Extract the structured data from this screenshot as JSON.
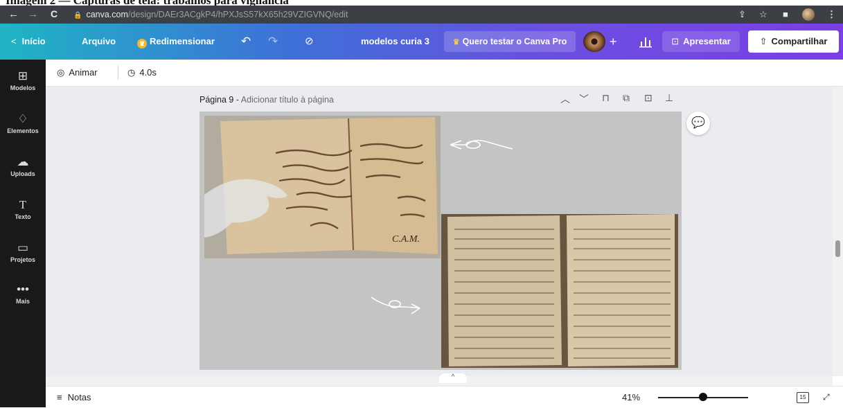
{
  "doc_caption": "Imagem 2 — Capturas de tela: trabalhos para vigilância",
  "browser": {
    "url_host": "canva.com",
    "url_path": "/design/DAEr3ACgkP4/hPXJsS57kX65h29VZIGVNQ/edit",
    "back_icon": "arrow-left-icon",
    "forward_icon": "arrow-right-icon",
    "reload_icon": "reload-icon"
  },
  "toolbar": {
    "home_label": "Início",
    "file_label": "Arquivo",
    "resize_label": "Redimensionar",
    "design_title": "modelos curia 3",
    "pro_label": "Quero testar o Canva Pro",
    "present_label": "Apresentar",
    "share_label": "Compartilhar"
  },
  "sidebar": {
    "items": [
      {
        "label": "Modelos",
        "icon": "templates-icon"
      },
      {
        "label": "Elementos",
        "icon": "elements-icon"
      },
      {
        "label": "Uploads",
        "icon": "upload-cloud-icon"
      },
      {
        "label": "Texto",
        "icon": "text-icon"
      },
      {
        "label": "Projetos",
        "icon": "folder-icon"
      },
      {
        "label": "Mais",
        "icon": "more-dots-icon"
      }
    ]
  },
  "subbar": {
    "animate_label": "Animar",
    "duration_label": "4.0s"
  },
  "page": {
    "title": "Página 9",
    "subtitle": "Adicionar título à página"
  },
  "footer": {
    "notes_label": "Notas",
    "zoom_label": "41%",
    "zoom_level": 0.41,
    "page_count": "15"
  }
}
